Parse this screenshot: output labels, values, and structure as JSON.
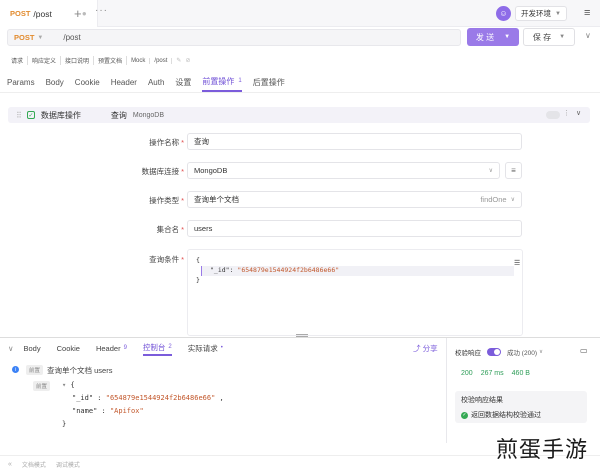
{
  "tabs": {
    "active": {
      "method": "POST",
      "name": "/post",
      "dot": "●"
    },
    "add": "+",
    "more": "···"
  },
  "env": {
    "avatar": "☺",
    "name": "开发环境",
    "menu_icon": "≡"
  },
  "request": {
    "method": "POST",
    "url": "/post",
    "send_label": "发 送",
    "save_label": "保 存",
    "more": "∨"
  },
  "crumbs": [
    "请求",
    "响应定义",
    "接口说明",
    "预置文档",
    "Mock",
    "/post"
  ],
  "request_tabs": [
    {
      "label": "Params"
    },
    {
      "label": "Body"
    },
    {
      "label": "Cookie"
    },
    {
      "label": "Header"
    },
    {
      "label": "Auth"
    },
    {
      "label": "设置"
    },
    {
      "label": "前置操作",
      "badge": "1",
      "active": true
    },
    {
      "label": "后置操作"
    }
  ],
  "pre_op": {
    "title": "数据库操作",
    "action": "查询",
    "db": "MongoDB"
  },
  "form": {
    "op_name": {
      "label": "操作名称",
      "value": "查询"
    },
    "db_conn": {
      "label": "数据库连接",
      "value": "MongoDB"
    },
    "op_type": {
      "label": "操作类型",
      "value": "查询单个文档",
      "hint": "findOne"
    },
    "collection": {
      "label": "集合名",
      "value": "users"
    },
    "query": {
      "label": "查询条件",
      "open": "{",
      "key": "\"_id\"",
      "colon": ": ",
      "value": "\"654879e1544924f2b6486e66\"",
      "close": "}"
    }
  },
  "bottom_tabs": [
    {
      "label": "Body"
    },
    {
      "label": "Cookie"
    },
    {
      "label": "Header",
      "n": "9"
    },
    {
      "label": "控制台",
      "n": "2",
      "active": true
    },
    {
      "label": "实际请求",
      "n": "•"
    }
  ],
  "share_label": "分享",
  "console": {
    "tag": "前置",
    "line": "查询单个文档  users",
    "tag2": "前置",
    "json": {
      "open": "{",
      "id_key": "\"_id\"",
      "id_val": "\"654879e1544924f2b6486e66\"",
      "name_key": "\"name\"",
      "name_val": "\"Apifox\"",
      "close": "}"
    }
  },
  "result": {
    "validate_label": "校验响应",
    "status_label": "成功 (200)",
    "code": "200",
    "time": "267 ms",
    "size": "460 B",
    "box_title": "校验响应结果",
    "box_ok": "返回数据结构校验通过"
  },
  "statusbar": {
    "collapse": "«",
    "doc_mode": "文档模式",
    "debug_mode": "调试模式"
  },
  "watermark": "煎蛋手游"
}
